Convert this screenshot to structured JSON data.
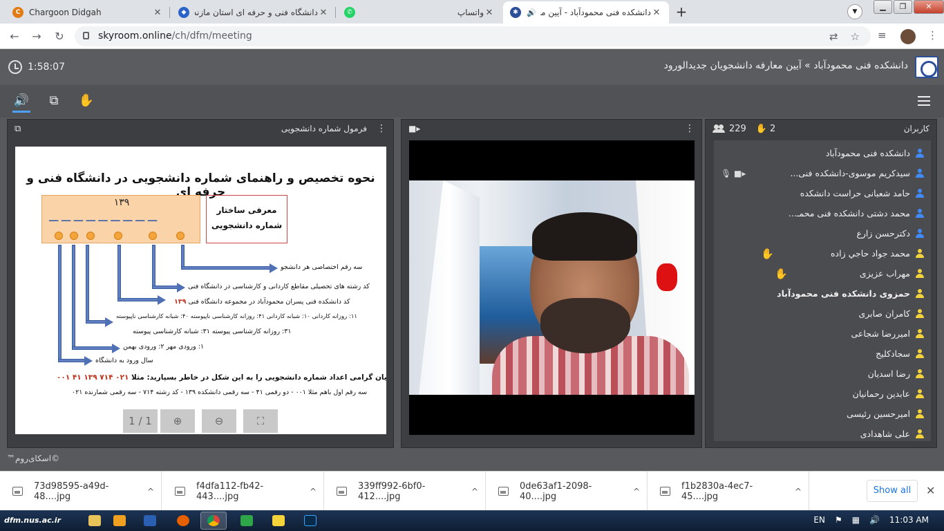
{
  "browser": {
    "tabs": [
      {
        "title": "Chargoon Didgah",
        "icon": "chargoon-icon",
        "color": "#e37b15",
        "active": false
      },
      {
        "title": "دانشگاه فنی و حرفه ای استان مازندران",
        "icon": "university-icon",
        "color": "#2b63c9",
        "active": false
      },
      {
        "title": "واتساپ",
        "icon": "whatsapp-icon",
        "color": "#25d366",
        "active": false
      },
      {
        "title": "دانشکده فنی محمودآباد - آیین معارفه ...",
        "icon": "skyroom-icon",
        "color": "#2d4f9a",
        "active": true
      }
    ],
    "url_host": "skyroom.online",
    "url_path": "/ch/dfm/meeting"
  },
  "app": {
    "timer": "1:58:07",
    "room_title": "دانشکده فنی محمودآباد » آیین معارفه دانشجویان جدیدالورود",
    "copyright": "©اسکای‌روم™"
  },
  "slide_panel": {
    "title": "فرمول شماره دانشجویی",
    "page_counter": "1 / 1",
    "slide": {
      "heading": "نحوه تخصیص و راهنمای شماره دانشجویی در دانشگاه فنی و حرفه ای",
      "number": "۱۳۹",
      "struct_line1": "معرفی ساختار",
      "struct_line2": "شماره دانشجویی",
      "lines": [
        "سه رقم اختصاصی هر دانشجو",
        "کد رشته های تحصیلی مقاطع کاردانی و کارشناسی در دانشگاه فنی",
        "کد دانشکده فنی پسران محمودآباد در مجموعه دانشگاه فنی",
        "۱۱: روزانه کاردانی  ۱۰: شبانه کاردانی  ۴۱: روزانه کارشناسی ناپیوسته  ۴۰: شبانه کارشناسی ناپیوسته",
        "۳۱: روزانه کارشناسی پیوسته  ۳۱: شبانه کارشناسی پیوسته",
        "۱: ورودی مهر  ۲: ورودی بهمن",
        "سال ورود به دانشگاه"
      ],
      "code_highlight": "۱۳۹",
      "note": "دانشجویان گرامی اعداد شماره دانشجویی را به این شکل در خاطر بسپارید:  مثلا",
      "note_example": "۰۲۱  ۷۱۴  ۱۳۹  ۴۱  ۰۰۱",
      "sub": "سه رقم اول باهم مثلا ۰۰۱  -  دو رقمی ۴۱  -  سه رقمی دانشکده ۱۳۹  -  کد رشته ۷۱۴  -  سه رقمی شمارنده ۰۲۱"
    }
  },
  "users_panel": {
    "title": "کاربران",
    "online_count": "229",
    "raised_hands": "2",
    "users": [
      {
        "name": "دانشکده فنی محمودآباد",
        "role": "blue",
        "bold": false,
        "hand": false,
        "media": false
      },
      {
        "name": "سیدکریم موسوی-دانشکده فنی...",
        "role": "blue",
        "bold": false,
        "hand": false,
        "media": true
      },
      {
        "name": "حامد شعبانی حراست دانشکده",
        "role": "blue",
        "bold": false,
        "hand": false,
        "media": false
      },
      {
        "name": "محمد دشتی دانشکده فنی محمـ...",
        "role": "blue",
        "bold": false,
        "hand": false,
        "media": false
      },
      {
        "name": "دکترحسن زارع",
        "role": "blue",
        "bold": false,
        "hand": false,
        "media": false
      },
      {
        "name": "محمد جواد حاجي زاده",
        "role": "yellow",
        "bold": false,
        "hand": true,
        "media": false
      },
      {
        "name": "مهراب عزیزی",
        "role": "yellow",
        "bold": false,
        "hand": true,
        "media": false
      },
      {
        "name": "حمزوی دانشکده فنی محمودآباد",
        "role": "yellow",
        "bold": true,
        "hand": false,
        "media": false
      },
      {
        "name": "کامران صابری",
        "role": "yellow",
        "bold": false,
        "hand": false,
        "media": false
      },
      {
        "name": "امیررضا شجاعی",
        "role": "yellow",
        "bold": false,
        "hand": false,
        "media": false
      },
      {
        "name": "سجادکلیج",
        "role": "yellow",
        "bold": false,
        "hand": false,
        "media": false
      },
      {
        "name": "رضا اسدیان",
        "role": "yellow",
        "bold": false,
        "hand": false,
        "media": false
      },
      {
        "name": "عابدین رحمانیان",
        "role": "yellow",
        "bold": false,
        "hand": false,
        "media": false
      },
      {
        "name": "امیرحسین رئیسی",
        "role": "yellow",
        "bold": false,
        "hand": false,
        "media": false
      },
      {
        "name": "علی شاهدادی",
        "role": "yellow",
        "bold": false,
        "hand": false,
        "media": false
      }
    ]
  },
  "downloads": {
    "files": [
      "73d98595-a49d-48....jpg",
      "f4dfa112-fb42-443....jpg",
      "339ff992-6bf0-412....jpg",
      "0de63af1-2098-40....jpg",
      "f1b2830a-4ec7-45....jpg"
    ],
    "show_all": "Show all"
  },
  "taskbar": {
    "start_label": "dfm.nus.ac.ir",
    "lang": "EN",
    "time": "11:03 AM"
  }
}
